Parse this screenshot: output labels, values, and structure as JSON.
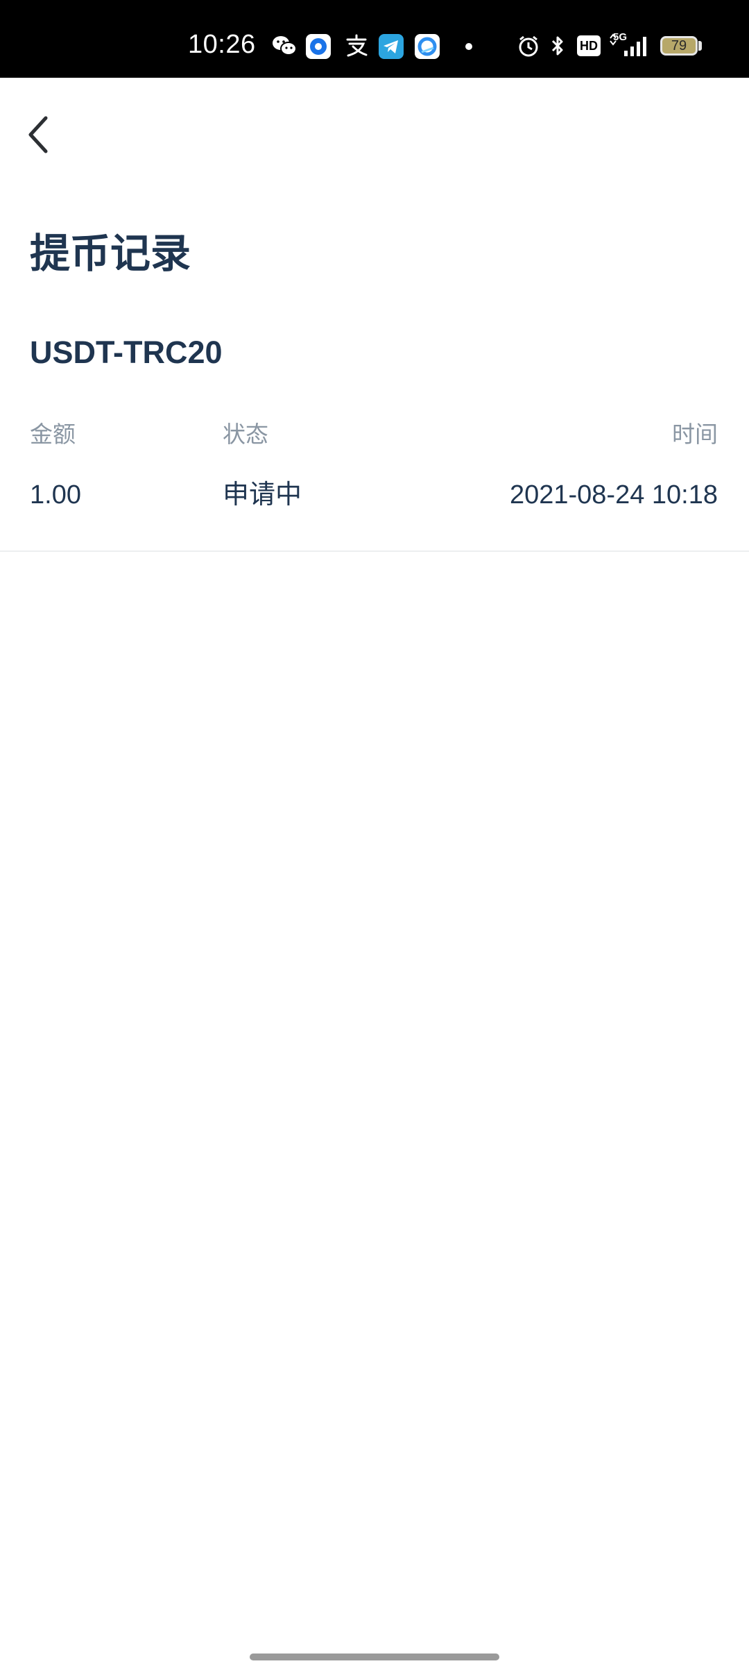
{
  "status_bar": {
    "time": "10:26",
    "notification_icons": [
      "wechat-icon",
      "app-circle-icon",
      "alipay-icon",
      "telegram-icon",
      "app-qq-browser-icon",
      "dot-icon"
    ],
    "system_icons": [
      "alarm-icon",
      "bluetooth-icon",
      "hd-icon",
      "signal-5g-icon"
    ],
    "battery_level": "79",
    "network_label": "5G",
    "hd_label": "HD"
  },
  "header": {
    "back_icon": "chevron-left-icon"
  },
  "page": {
    "title": "提币记录",
    "coin": "USDT-TRC20"
  },
  "table": {
    "columns": [
      "金额",
      "状态",
      "时间"
    ],
    "rows": [
      {
        "amount": "1.00",
        "status": "申请中",
        "time": "2021-08-24 10:18"
      }
    ]
  },
  "colors": {
    "title": "#1f3550",
    "header_text": "#8a96a3",
    "divider": "#eceef0",
    "status_bar_bg": "#000000"
  }
}
